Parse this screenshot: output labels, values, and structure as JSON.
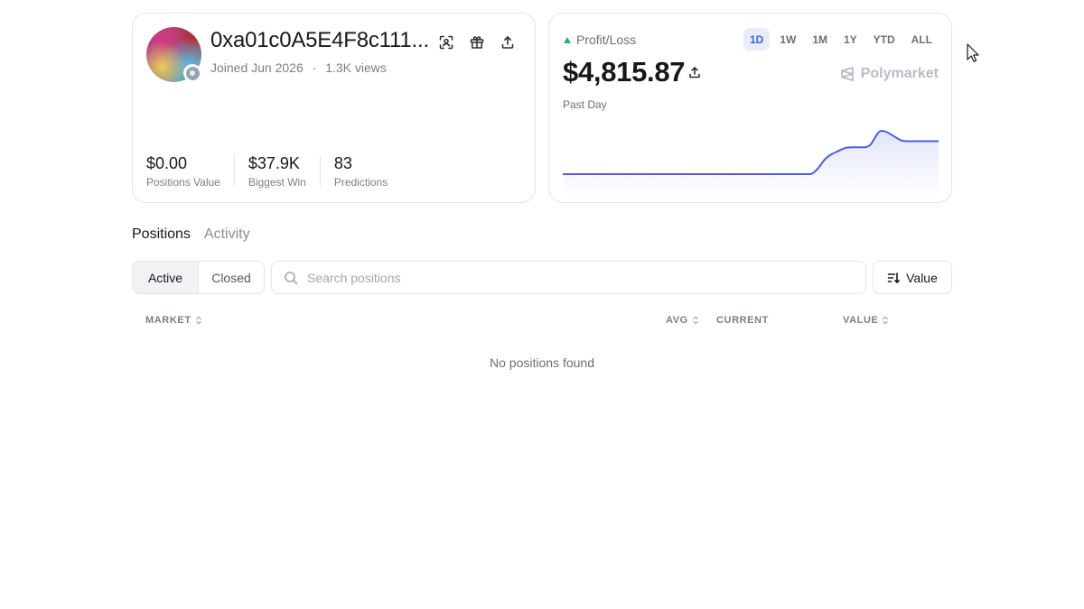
{
  "profile": {
    "username": "0xa01c0A5E4F8c111...",
    "joined": "Joined Jun 2026",
    "views": "1.3K views",
    "stats": [
      {
        "value": "$0.00",
        "label": "Positions Value"
      },
      {
        "value": "$37.9K",
        "label": "Biggest Win"
      },
      {
        "value": "83",
        "label": "Predictions"
      }
    ],
    "icons": [
      "scan-icon",
      "gift-icon",
      "share-icon"
    ]
  },
  "pnl": {
    "label": "Profit/Loss",
    "value": "$4,815.87",
    "period": "Past Day",
    "brand": "Polymarket",
    "ranges": [
      "1D",
      "1W",
      "1M",
      "1Y",
      "YTD",
      "ALL"
    ],
    "active_range": "1D",
    "trend_color": "#2fb35a",
    "line_color_start": "#7b4fd6",
    "line_color_end": "#3f63d8"
  },
  "chart_data": {
    "type": "area",
    "values": [
      0,
      0,
      0,
      0,
      0,
      0,
      0,
      0,
      0,
      0,
      0,
      0,
      0,
      0,
      0,
      0,
      0,
      0,
      0,
      0,
      0,
      0,
      0,
      0,
      0,
      0,
      0,
      0,
      0,
      0,
      0,
      0,
      0,
      0,
      0,
      0,
      0,
      0,
      0,
      0,
      0,
      0,
      0,
      0,
      0,
      0,
      0,
      0,
      0,
      0,
      0,
      0,
      0,
      0,
      0,
      0,
      0,
      0,
      0,
      0,
      0.08,
      0.2,
      0.34,
      0.42,
      0.48,
      0.52,
      0.57,
      0.61,
      0.62,
      0.62,
      0.62,
      0.62,
      0.62,
      0.68,
      0.86,
      1.0,
      1.0,
      0.96,
      0.9,
      0.84,
      0.78,
      0.76,
      0.76,
      0.76,
      0.76,
      0.76,
      0.76,
      0.76,
      0.76,
      0.76
    ],
    "ylim": [
      0,
      1
    ]
  },
  "tabs": [
    {
      "label": "Positions",
      "active": true
    },
    {
      "label": "Activity",
      "active": false
    }
  ],
  "filters": {
    "segments": [
      {
        "label": "Active",
        "active": true
      },
      {
        "label": "Closed",
        "active": false
      }
    ],
    "search_placeholder": "Search positions",
    "sort_label": "Value"
  },
  "table": {
    "columns": [
      "MARKET",
      "AVG",
      "CURRENT",
      "VALUE"
    ],
    "empty_message": "No positions found"
  }
}
